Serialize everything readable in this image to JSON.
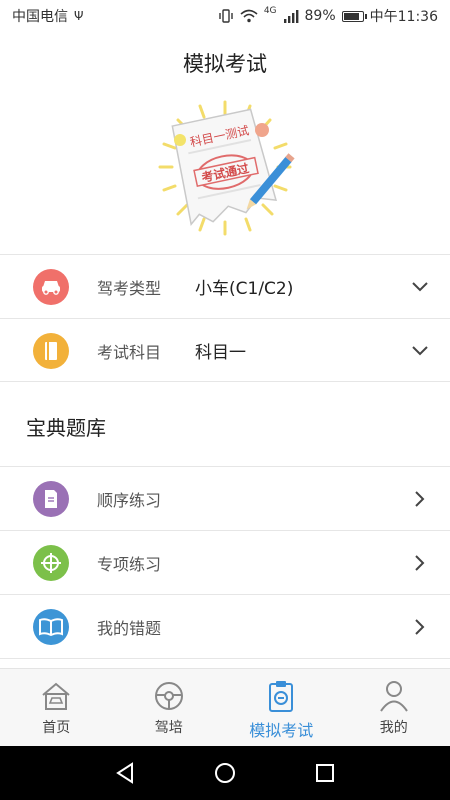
{
  "status_bar": {
    "carrier": "中国电信",
    "usb": "Ψ",
    "network_badge": "4G",
    "battery_percent": "89%",
    "battery_level": 0.89,
    "time": "中午11:36"
  },
  "header": {
    "title": "模拟考试"
  },
  "hero": {
    "paper_title": "科目一测试",
    "stamp_text": "考试通过"
  },
  "selectors": [
    {
      "label": "驾考类型",
      "value": "小车(C1/C2)",
      "icon": "car-icon",
      "color": "#f0706a"
    },
    {
      "label": "考试科目",
      "value": "科目一",
      "icon": "book-icon",
      "color": "#f2b13a"
    }
  ],
  "question_bank": {
    "title": "宝典题库",
    "items": [
      {
        "label": "顺序练习",
        "icon": "document-icon",
        "color": "#9a71b5"
      },
      {
        "label": "专项练习",
        "icon": "target-icon",
        "color": "#7cc04a"
      },
      {
        "label": "我的错题",
        "icon": "open-book-icon",
        "color": "#3d95d6"
      }
    ]
  },
  "bottom_nav": {
    "items": [
      {
        "label": "首页",
        "icon": "home-car-icon",
        "active": false
      },
      {
        "label": "驾培",
        "icon": "steering-wheel-icon",
        "active": false
      },
      {
        "label": "模拟考试",
        "icon": "exam-clipboard-icon",
        "active": true
      },
      {
        "label": "我的",
        "icon": "person-icon",
        "active": false
      }
    ],
    "active_color": "#3a8fd8"
  }
}
